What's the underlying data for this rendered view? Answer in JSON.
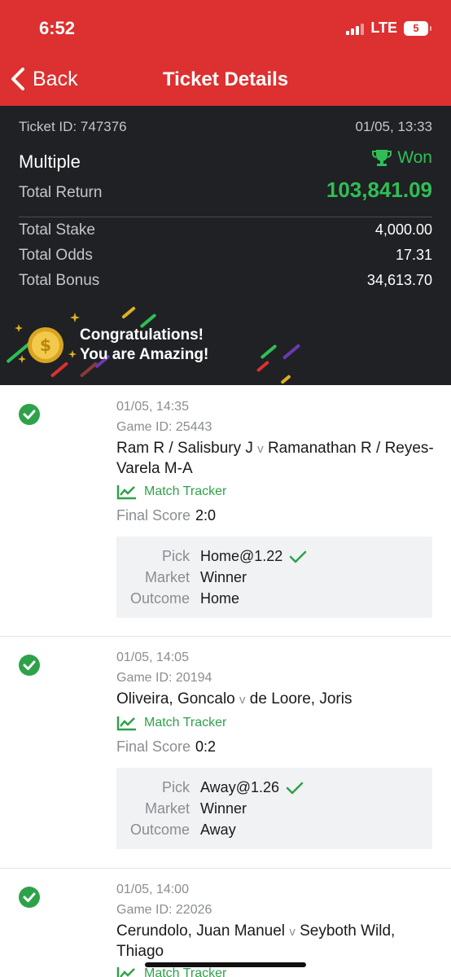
{
  "status_bar": {
    "time": "6:52",
    "network": "LTE",
    "battery": "5"
  },
  "nav": {
    "back_label": "Back",
    "title": "Ticket Details"
  },
  "summary": {
    "ticket_id": "Ticket ID: 747376",
    "date": "01/05, 13:33",
    "bet_type": "Multiple",
    "status": "Won",
    "total_return_label": "Total Return",
    "total_return": "103,841.09",
    "rows": [
      {
        "label": "Total Stake",
        "value": "4,000.00"
      },
      {
        "label": "Total Odds",
        "value": "17.31"
      },
      {
        "label": "Total Bonus",
        "value": "34,613.70"
      }
    ],
    "congrats_line1": "Congratulations!",
    "congrats_line2": "You are Amazing!"
  },
  "selections": [
    {
      "datetime": "01/05, 14:35",
      "game_id": "Game ID: 25443",
      "home": "Ram R / Salisbury J",
      "vs": "v",
      "away": "Ramanathan R / Reyes-Varela M-A",
      "tracker": "Match Tracker",
      "final_score_label": "Final Score",
      "final_score": "2:0",
      "pick_label": "Pick",
      "pick": "Home@1.22",
      "market_label": "Market",
      "market": "Winner",
      "outcome_label": "Outcome",
      "outcome": "Home"
    },
    {
      "datetime": "01/05, 14:05",
      "game_id": "Game ID: 20194",
      "home": "Oliveira, Goncalo",
      "vs": "v",
      "away": "de Loore, Joris",
      "tracker": "Match Tracker",
      "final_score_label": "Final Score",
      "final_score": "0:2",
      "pick_label": "Pick",
      "pick": "Away@1.26",
      "market_label": "Market",
      "market": "Winner",
      "outcome_label": "Outcome",
      "outcome": "Away"
    },
    {
      "datetime": "01/05, 14:00",
      "game_id": "Game ID: 22026",
      "home": "Cerundolo, Juan Manuel",
      "vs": "v",
      "away": "Seyboth Wild, Thiago",
      "tracker": "Match Tracker"
    }
  ],
  "colors": {
    "header": "#dd3030",
    "dark": "#1f2124",
    "win_green": "#2fbe55",
    "tracker_green": "#2ea24a"
  }
}
